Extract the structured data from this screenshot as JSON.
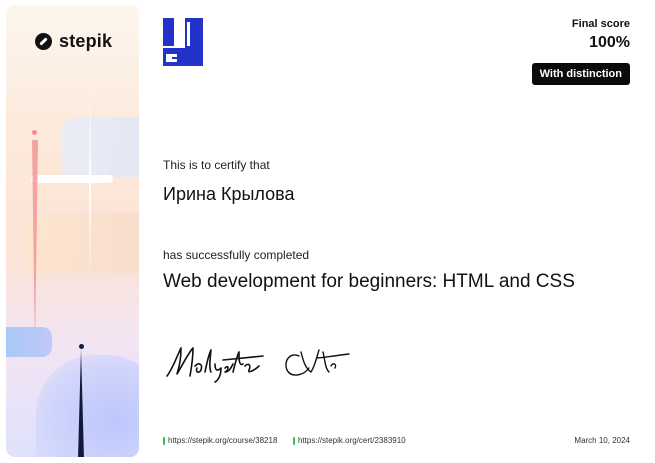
{
  "sidebar": {
    "logo_icon": "stepik-logo-icon",
    "logo_text": "stepik"
  },
  "header": {
    "final_score_label": "Final score",
    "final_score_value": "100%",
    "distinction_badge": "With distinction"
  },
  "body": {
    "certify_text": "This is to certify that",
    "recipient_name": "Ирина Крылова",
    "completed_text": "has successfully completed",
    "course_title": "Web development for beginners: HTML and CSS"
  },
  "footer": {
    "course_link": "https://stepik.org/course/38218",
    "cert_link": "https://stepik.org/cert/2383910",
    "date": "March 10, 2024",
    "accent_color": "#32c04a"
  },
  "colors": {
    "course_logo_blue": "#2233cc",
    "badge_bg": "#0b0b0b"
  }
}
